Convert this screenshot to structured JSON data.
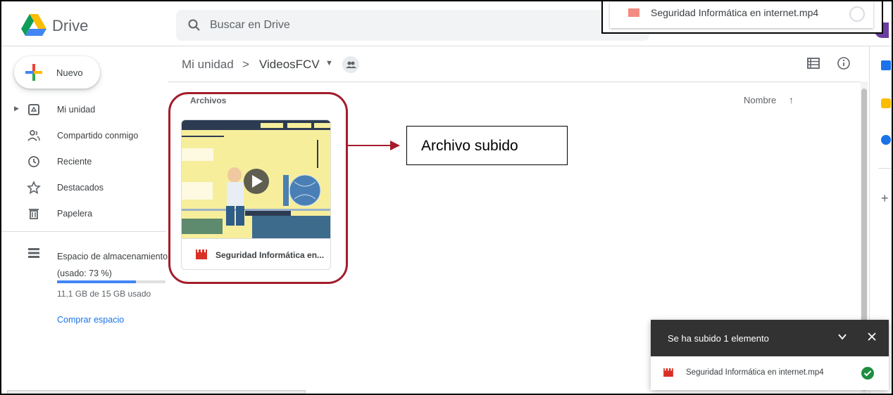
{
  "header": {
    "app_name": "Drive",
    "search_placeholder": "Buscar en Drive"
  },
  "upload_popup_top": {
    "file_name": "Seguridad Informática en internet.mp4",
    "status": "in-progress"
  },
  "sidebar": {
    "new_label": "Nuevo",
    "items": [
      {
        "label": "Mi unidad",
        "icon": "drive-icon"
      },
      {
        "label": "Compartido conmigo",
        "icon": "people-icon"
      },
      {
        "label": "Reciente",
        "icon": "clock-icon"
      },
      {
        "label": "Destacados",
        "icon": "star-icon"
      },
      {
        "label": "Papelera",
        "icon": "trash-icon"
      }
    ],
    "storage": {
      "label": "Espacio de almacenamiento (usado: 73 %)",
      "percent": 73,
      "used_text": "11,1 GB de 15 GB usado",
      "buy_label": "Comprar espacio"
    }
  },
  "main": {
    "breadcrumb_root": "Mi unidad",
    "breadcrumb_sep": ">",
    "breadcrumb_folder": "VideosFCV",
    "section_title": "Archivos",
    "sort_label": "Nombre",
    "sort_arrow": "↑",
    "file": {
      "name": "Seguridad Informática en...",
      "type": "video"
    },
    "annotation": "Archivo subido"
  },
  "upload_panel": {
    "title": "Se ha subido 1 elemento",
    "file_name": "Seguridad Informática en internet.mp4",
    "status": "complete"
  },
  "colors": {
    "brand_blue": "#1a73e8",
    "highlight": "#a31c2b",
    "panel_dark": "#323232",
    "success": "#1e8e3e"
  }
}
